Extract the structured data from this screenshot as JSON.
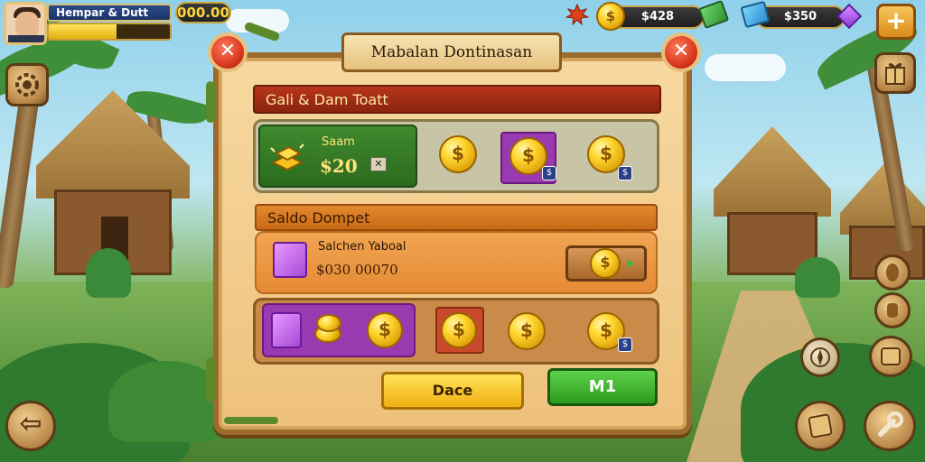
{
  "hud": {
    "player_name": "Hempar & Dutt",
    "xp_value": "$3",
    "xp_progress": 0.56,
    "gold_display": "000.00",
    "currency_1": "$428",
    "currency_2": "$350"
  },
  "dialog": {
    "title": "Mabalan Dontinasan",
    "section1_header": "Gali & Dam Toatt",
    "tile_label": "Saam",
    "tile_amount": "$20",
    "tile_close": "✕",
    "row1_badges": [
      "$",
      "$"
    ],
    "section2_header": "Saldo Dompet",
    "saldo_label": "Salchen Yaboal",
    "saldo_value": "$030 00070",
    "row3_badge": "$",
    "button_left": "Dace",
    "button_right": "M1"
  },
  "icons": {
    "coin_symbol": "$",
    "close_glyph": "✕",
    "plus_glyph": "+",
    "back_glyph": "⇦"
  },
  "colors": {
    "accent_red": "#b8361a",
    "accent_orange": "#e38a2e",
    "button_yellow": "#ffe25a",
    "button_green": "#3fb82e",
    "panel_wood": "#9b6a2c"
  }
}
